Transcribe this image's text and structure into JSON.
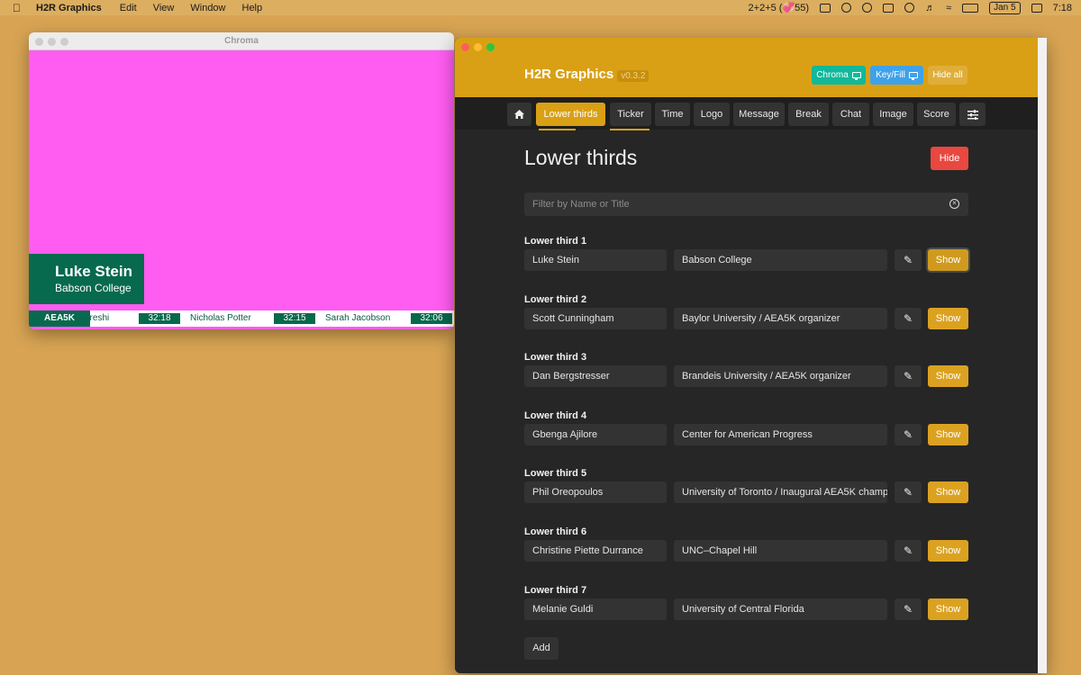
{
  "menubar": {
    "app_name": "H2R Graphics",
    "menus": [
      "Edit",
      "View",
      "Window",
      "Help"
    ],
    "status_text": "2+2+5 (💞55)",
    "date": "Jan 5",
    "time": "7:18"
  },
  "chroma": {
    "window_title": "Chroma",
    "background_color": "#ff5cf1",
    "lower_third": {
      "name": "Luke Stein",
      "title": "Babson College"
    },
    "ticker": {
      "label": "AEA5K",
      "items": [
        {
          "name": "ureshi",
          "time": "32:18"
        },
        {
          "name": "Nicholas Potter",
          "time": "32:15"
        },
        {
          "name": "Sarah Jacobson",
          "time": "32:06"
        }
      ]
    }
  },
  "app": {
    "brand": "H2R Graphics",
    "version": "v0.3.2",
    "header_buttons": {
      "chroma": "Chroma",
      "keyfill": "Key/Fill",
      "hide_all": "Hide all"
    },
    "tabs": [
      "Lower thirds",
      "Ticker",
      "Time",
      "Logo",
      "Message",
      "Break",
      "Chat",
      "Image",
      "Score"
    ],
    "active_tab": "Lower thirds",
    "page_title": "Lower thirds",
    "hide_label": "Hide",
    "filter_placeholder": "Filter by Name or Title",
    "show_label": "Show",
    "add_label": "Add",
    "lower_thirds": [
      {
        "label": "Lower third 1",
        "name": "Luke Stein",
        "title": "Babson College",
        "live": true
      },
      {
        "label": "Lower third 2",
        "name": "Scott Cunningham",
        "title": "Baylor University / AEA5K organizer",
        "live": false
      },
      {
        "label": "Lower third 3",
        "name": "Dan Bergstresser",
        "title": " Brandeis University / AEA5K organizer",
        "live": false
      },
      {
        "label": "Lower third 4",
        "name": "Gbenga Ajilore",
        "title": "Center for American Progress",
        "live": false
      },
      {
        "label": "Lower third 5",
        "name": "Phil Oreopoulos",
        "title": "University of Toronto / Inaugural AEA5K champ",
        "live": false
      },
      {
        "label": "Lower third 6",
        "name": "Christine Piette Durrance",
        "title": "UNC–Chapel Hill",
        "live": false
      },
      {
        "label": "Lower third 7",
        "name": "Melanie Guldi",
        "title": "University of Central Florida",
        "live": false
      }
    ]
  }
}
